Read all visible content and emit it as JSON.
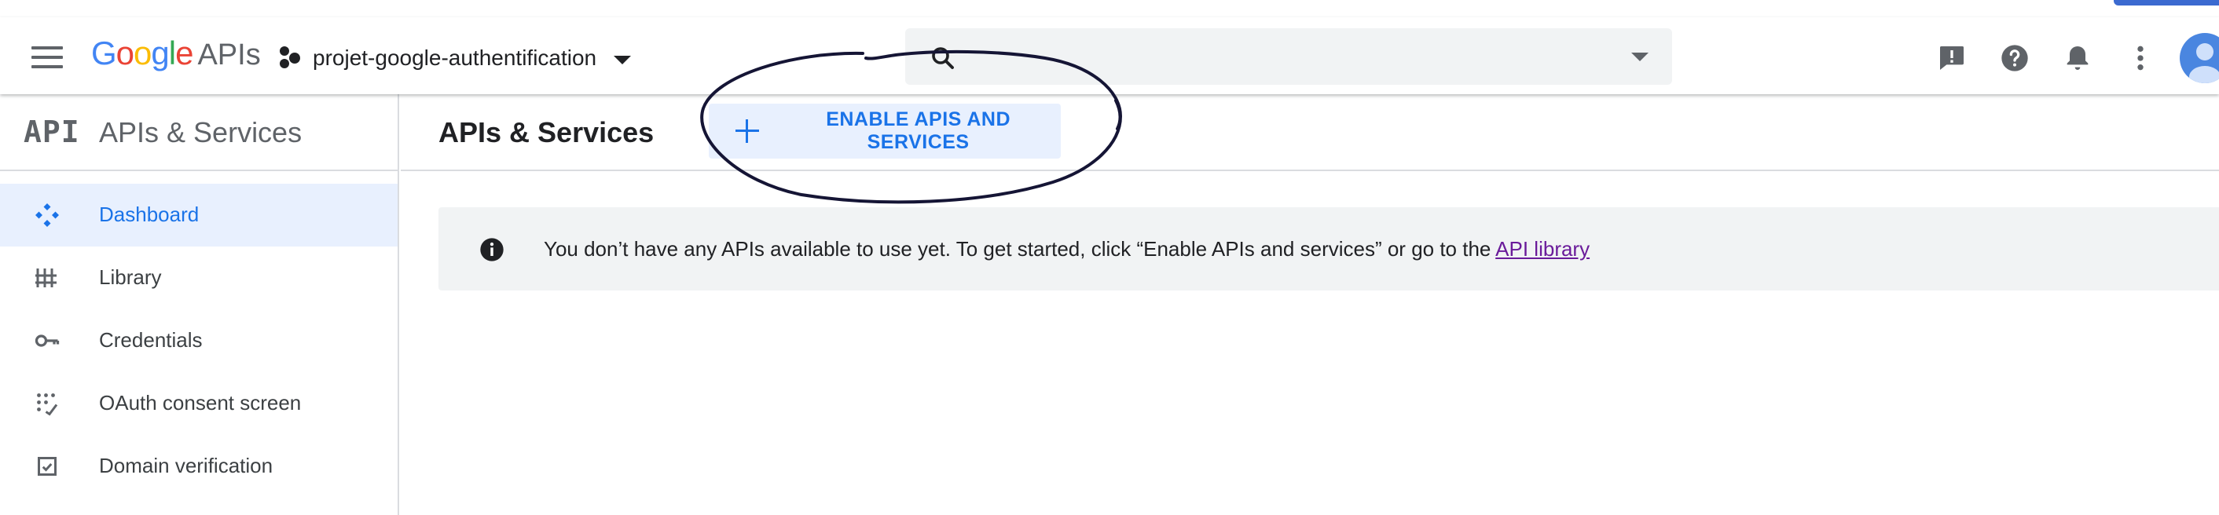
{
  "header": {
    "brand": {
      "google": "Google",
      "apis": "APIs"
    },
    "project": {
      "name": "projet-google-authentification"
    },
    "search": {
      "value": "",
      "placeholder": ""
    },
    "icons": [
      "hamburger-menu-icon",
      "project-icon",
      "search-icon",
      "feedback-icon",
      "help-icon",
      "notifications-icon",
      "more-vert-icon",
      "account-avatar"
    ]
  },
  "sidebar": {
    "logo": "API",
    "title": "APIs & Services",
    "items": [
      {
        "label": "Dashboard",
        "icon": "dashboard-icon",
        "active": true
      },
      {
        "label": "Library",
        "icon": "library-icon",
        "active": false
      },
      {
        "label": "Credentials",
        "icon": "key-icon",
        "active": false
      },
      {
        "label": "OAuth consent screen",
        "icon": "consent-icon",
        "active": false
      },
      {
        "label": "Domain verification",
        "icon": "checkbox-icon",
        "active": false
      }
    ]
  },
  "main": {
    "title": "APIs & Services",
    "enable_button": "ENABLE APIS AND SERVICES",
    "info": {
      "text": "You don’t have any APIs available to use yet. To get started, click “Enable APIs and services” or go to the ",
      "link": "API library"
    }
  },
  "colors": {
    "accent": "#1a73e8",
    "active_bg": "#e8f0fe",
    "banner_bg": "#f1f3f4",
    "link": "#6a1b9a",
    "annotation": "#151535"
  }
}
